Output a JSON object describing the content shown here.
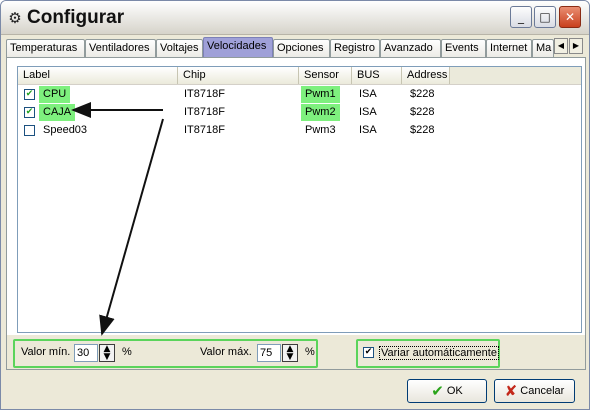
{
  "window": {
    "title": "Configurar",
    "app_icon": "gear-icon",
    "controls": {
      "minimize": "_",
      "maximize": "□",
      "close": "✕"
    }
  },
  "tabs": [
    {
      "label": "Temperaturas"
    },
    {
      "label": "Ventiladores"
    },
    {
      "label": "Voltajes"
    },
    {
      "label": "Velocidades",
      "active": true
    },
    {
      "label": "Opciones"
    },
    {
      "label": "Registro"
    },
    {
      "label": "Avanzado"
    },
    {
      "label": "Events"
    },
    {
      "label": "Internet"
    },
    {
      "label": "Ma"
    }
  ],
  "tab_scroll": {
    "left": "◀",
    "right": "▶"
  },
  "list": {
    "columns": [
      "Label",
      "Chip",
      "Sensor",
      "BUS",
      "Address"
    ],
    "rows": [
      {
        "checked": true,
        "label": "CPU",
        "chip": "IT8718F",
        "sensor": "Pwm1",
        "bus": "ISA",
        "address": "$228",
        "highlight": true
      },
      {
        "checked": true,
        "label": "CAJA",
        "chip": "IT8718F",
        "sensor": "Pwm2",
        "bus": "ISA",
        "address": "$228",
        "highlight": true
      },
      {
        "checked": false,
        "label": "Speed03",
        "chip": "IT8718F",
        "sensor": "Pwm3",
        "bus": "ISA",
        "address": "$228",
        "highlight": false
      }
    ]
  },
  "controls": {
    "min_label": "Valor mín.",
    "min_value": "30",
    "min_unit": "%",
    "max_label": "Valor máx.",
    "max_value": "75",
    "max_unit": "%",
    "auto_label": "Variar automáticamente",
    "auto_checked": true
  },
  "buttons": {
    "ok": "OK",
    "cancel": "Cancelar"
  },
  "colors": {
    "highlight": "#7ef07e",
    "active_tab": "#9fa0d8",
    "annotation_box": "#5bd45b"
  }
}
